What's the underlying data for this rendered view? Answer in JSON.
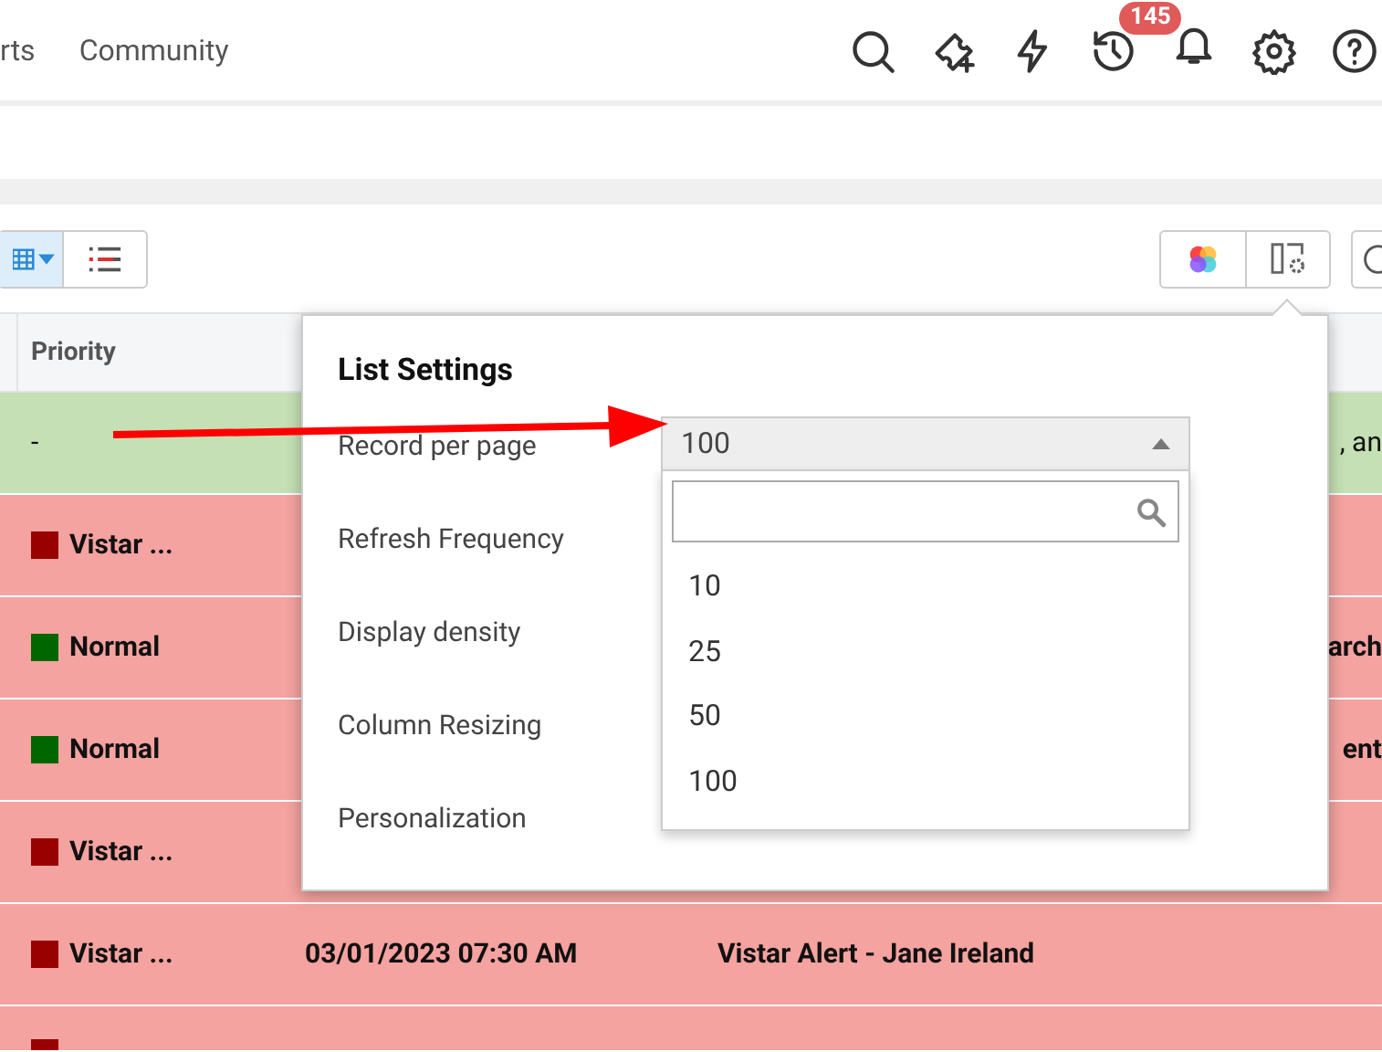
{
  "top_nav": {
    "links": [
      "rts",
      "Community"
    ],
    "notification_count": "145"
  },
  "table": {
    "columns": [
      "Priority"
    ],
    "rows": [
      {
        "color": "#c5e0b4",
        "priority": {
          "label": "-"
        },
        "date": "",
        "subject": "",
        "column_5": ", an"
      },
      {
        "color": "#f4a3a0",
        "priority": {
          "label": "Vistar ...",
          "color": "#990000"
        },
        "column_5": ""
      },
      {
        "color": "#f4a3a0",
        "priority": {
          "label": "Normal",
          "color": "#006600"
        },
        "column_5": "arch"
      },
      {
        "color": "#f4a3a0",
        "priority": {
          "label": "Normal",
          "color": "#006600"
        },
        "column_5": "ent"
      },
      {
        "color": "#f4a3a0",
        "priority": {
          "label": "Vistar ...",
          "color": "#990000"
        },
        "column_5": ""
      },
      {
        "color": "#f4a3a0",
        "priority": {
          "label": "Vistar ...",
          "color": "#990000"
        },
        "date": "03/01/2023 07:30 AM",
        "subject": "Vistar Alert - Jane Ireland"
      },
      {
        "color": "#f4a3a0",
        "priority": {
          "color": "#990000"
        }
      }
    ]
  },
  "list_settings": {
    "title": "List Settings",
    "settings": [
      {
        "label": "Record per page",
        "kind": "select",
        "value": "100",
        "expanded": true
      },
      {
        "label": "Refresh Frequency",
        "kind": "hidden"
      },
      {
        "label": "Display density",
        "kind": "hidden"
      },
      {
        "label": "Column Resizing",
        "kind": "hidden"
      },
      {
        "label": "Personalization",
        "kind": "field"
      }
    ],
    "dropdown_options": [
      "10",
      "25",
      "50",
      "100"
    ]
  }
}
